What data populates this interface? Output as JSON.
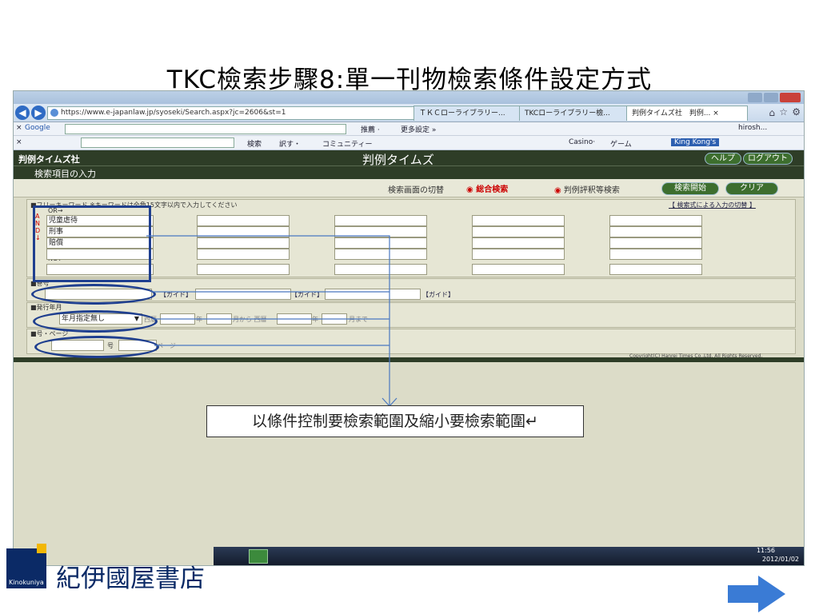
{
  "slide": {
    "title": "TKC檢索步驟8:單一刊物檢索條件設定方式",
    "callout": "以條件控制要檢索範圍及縮小要檢索範圍↵",
    "brand": "紀伊國屋書店",
    "logo_text": "Kinokuniya"
  },
  "browser": {
    "url": "https://www.e-japanlaw.jp/syoseki/Search.aspx?jc=2606&st=1",
    "tabs": [
      "ＴＫＣローライブラリー...",
      "TKCローライブラリー檢...",
      "判例タイムズ社　判例... ×"
    ],
    "search_bar_text": "Google",
    "toolbar_items": [
      "推薦 ·",
      "更多設定 »"
    ],
    "bar3_items": [
      "検索",
      "訳す・",
      "コミュニティー",
      "Casino·",
      "ゲーム",
      "King Kong's"
    ],
    "user": "hirosh..."
  },
  "app": {
    "logo": "判例タイムズ社",
    "title": "判例タイムズ",
    "help": "ヘルプ",
    "logout": "ログアウト",
    "section_title": "検索項目の入力",
    "mode_label": "検索画面の切替",
    "mode_option1": "総合検索",
    "mode_option2": "判例評釈等検索",
    "search_btn": "検索開始",
    "clear_btn": "クリア",
    "kw_hint": "■フリーキーワード ※キーワードは全角15文字以内で入力してください",
    "kw_link": "【 検索式による入力の切替 】",
    "or_label": "OR→",
    "and_label": "AND↓",
    "not_label": "NOT→",
    "keywords": [
      "児童虐待",
      "刑事",
      "賠償"
    ],
    "vol_label": "■巻号",
    "vol_guide1": "【ガイド】",
    "vol_guide2": "【ガイド】",
    "vol_guide3": "【ガイド】",
    "date_label": "■発行年月",
    "date_select": "年月指定無し",
    "date_era": "西暦",
    "date_text1": "年",
    "date_text2": "月から 西暦",
    "date_text3": "年",
    "date_text4": "月まで",
    "page_label": "■号・ページ",
    "page_go": "号",
    "page_pg": "ページ",
    "copyright": "Copyright(C) Hanrei Times Co.,Ltd. All Rights Reserved."
  },
  "taskbar": {
    "time": "11:56",
    "date": "2012/01/02"
  },
  "colors": {
    "header_dark": "#2e3d27",
    "ellipse": "#1f3f8f",
    "brand": "#0b2a66",
    "arrow": "#3a7bd5"
  }
}
